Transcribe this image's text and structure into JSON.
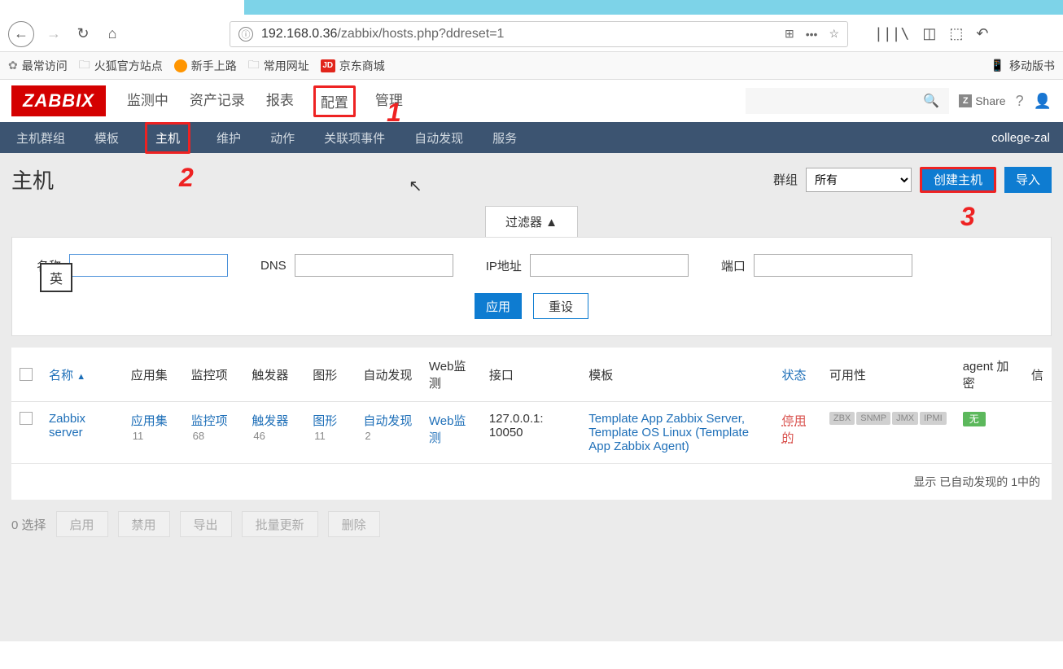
{
  "browser": {
    "url_host": "192.168.0.36",
    "url_path": "/zabbix/hosts.php?ddreset=1",
    "url_scheme_icon": "ⓘ",
    "ellipsis": "•••",
    "mobile_label": "移动版书"
  },
  "bookmarks": {
    "most_visited": "最常访问",
    "firefox_official": "火狐官方站点",
    "new_to_firefox": "新手上路",
    "common_sites": "常用网址",
    "jd_label": "京东商城",
    "jd_icon": "JD"
  },
  "zabbix": {
    "logo": "ZABBIX",
    "share": "Share",
    "profile_name": "college-zal"
  },
  "main_nav": {
    "monitoring": "监测中",
    "inventory": "资产记录",
    "reports": "报表",
    "configuration": "配置",
    "administration": "管理"
  },
  "sub_nav": {
    "host_groups": "主机群组",
    "templates": "模板",
    "hosts": "主机",
    "maintenance": "维护",
    "actions": "动作",
    "correlation": "关联项事件",
    "discovery": "自动发现",
    "services": "服务"
  },
  "page": {
    "title": "主机",
    "group_label": "群组",
    "group_value": "所有",
    "create_host": "创建主机",
    "import": "导入"
  },
  "filter": {
    "tab_label": "过滤器 ▲",
    "name_label": "名称",
    "dns_label": "DNS",
    "ip_label": "IP地址",
    "port_label": "端口",
    "apply": "应用",
    "reset": "重设",
    "ime": "英"
  },
  "table": {
    "headers": {
      "name": "名称",
      "applications": "应用集",
      "items": "监控项",
      "triggers": "触发器",
      "graphs": "图形",
      "discovery": "自动发现",
      "web": "Web监测",
      "interface": "接口",
      "templates": "模板",
      "status": "状态",
      "availability": "可用性",
      "agent_encryption": "agent 加密",
      "info": "信"
    },
    "row": {
      "name": "Zabbix server",
      "applications_label": "应用集",
      "applications_count": "11",
      "items_label": "监控项",
      "items_count": "68",
      "triggers_label": "触发器",
      "triggers_count": "46",
      "graphs_label": "图形",
      "graphs_count": "11",
      "discovery_label": "自动发现",
      "discovery_count": "2",
      "web_label": "Web监测",
      "interface": "127.0.0.1: 10050",
      "templates": "Template App Zabbix Server, Template OS Linux (Template App Zabbix Agent)",
      "status": "停用的",
      "avail_zbx": "ZBX",
      "avail_snmp": "SNMP",
      "avail_jmx": "JMX",
      "avail_ipmi": "IPMI",
      "encryption": "无"
    },
    "footer": "显示 已自动发现的 1中的"
  },
  "actions": {
    "selected": "0 选择",
    "enable": "启用",
    "disable": "禁用",
    "export": "导出",
    "mass_update": "批量更新",
    "delete": "删除"
  },
  "annotations": {
    "n1": "1",
    "n2": "2",
    "n3": "3"
  }
}
